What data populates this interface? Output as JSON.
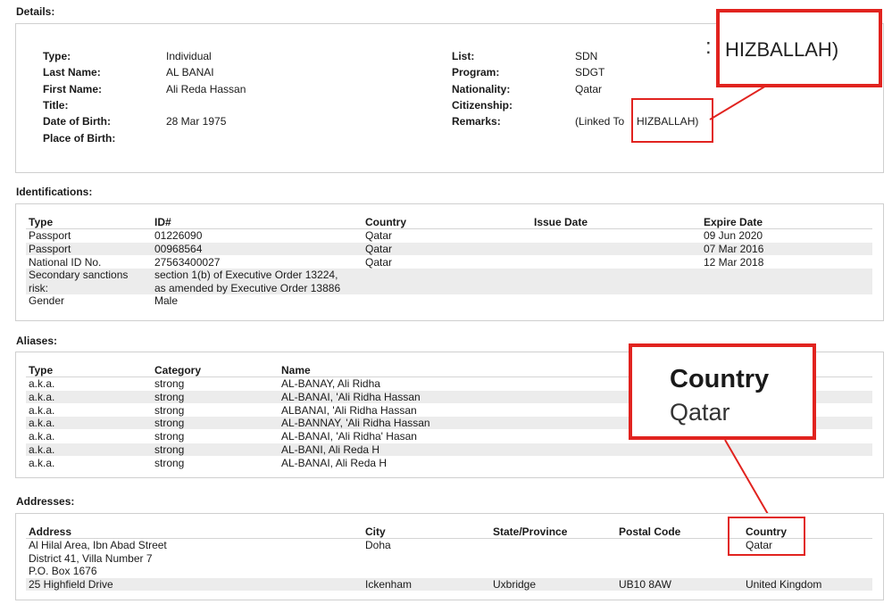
{
  "details": {
    "heading": "Details:",
    "left_fields": [
      {
        "label": "Type:",
        "value": "Individual"
      },
      {
        "label": "Last Name:",
        "value": "AL BANAI"
      },
      {
        "label": "First Name:",
        "value": "Ali Reda Hassan"
      },
      {
        "label": "Title:",
        "value": ""
      },
      {
        "label": "Date of Birth:",
        "value": "28 Mar 1975"
      },
      {
        "label": "Place of Birth:",
        "value": ""
      }
    ],
    "right_fields": [
      {
        "label": "List:",
        "value": "SDN"
      },
      {
        "label": "Program:",
        "value": "SDGT"
      },
      {
        "label": "Nationality:",
        "value": "Qatar"
      },
      {
        "label": "Citizenship:",
        "value": ""
      },
      {
        "label": "Remarks:",
        "value": "(Linked To"
      }
    ],
    "remarks_highlight": "HIZBALLAH)",
    "zoom_text": "HIZBALLAH)",
    "zoom_partial_char": ":"
  },
  "identifications": {
    "heading": "Identifications:",
    "headers": [
      "Type",
      "ID#",
      "Country",
      "Issue Date",
      "Expire Date"
    ],
    "rows": [
      [
        "Passport",
        "01226090",
        "Qatar",
        "",
        "09 Jun 2020"
      ],
      [
        "Passport",
        "00968564",
        "Qatar",
        "",
        "07 Mar 2016"
      ],
      [
        "National ID No.",
        "27563400027",
        "Qatar",
        "",
        "12 Mar 2018"
      ],
      [
        "Secondary sanctions",
        "section 1(b) of Executive Order 13224,",
        "",
        "",
        ""
      ],
      [
        "risk:",
        "as amended by Executive Order 13886",
        "",
        "",
        ""
      ],
      [
        "Gender",
        "Male",
        "",
        "",
        ""
      ]
    ]
  },
  "aliases": {
    "heading": "Aliases:",
    "headers": [
      "Type",
      "Category",
      "Name"
    ],
    "rows": [
      [
        "a.k.a.",
        "strong",
        "AL-BANAY, Ali Ridha"
      ],
      [
        "a.k.a.",
        "strong",
        "AL-BANAI, 'Ali Ridha Hassan"
      ],
      [
        "a.k.a.",
        "strong",
        "ALBANAI, 'Ali Ridha Hassan"
      ],
      [
        "a.k.a.",
        "strong",
        "AL-BANNAY, 'Ali Ridha Hassan"
      ],
      [
        "a.k.a.",
        "strong",
        "AL-BANAI, 'Ali Ridha' Hasan"
      ],
      [
        "a.k.a.",
        "strong",
        "AL-BANI, Ali Reda H"
      ],
      [
        "a.k.a.",
        "strong",
        "AL-BANAI, Ali Reda H"
      ]
    ],
    "zoom_header": "Country",
    "zoom_value": "Qatar"
  },
  "addresses": {
    "heading": "Addresses:",
    "headers": [
      "Address",
      "City",
      "State/Province",
      "Postal Code",
      "Country"
    ],
    "rows": [
      [
        "Al Hilal Area, Ibn Abad Street",
        "Doha",
        "",
        "",
        "Qatar"
      ],
      [
        "District 41, Villa Number 7",
        "",
        "",
        "",
        ""
      ],
      [
        "P.O. Box 1676",
        "",
        "",
        "",
        ""
      ],
      [
        "25 Highfield Drive",
        "Ickenham",
        "Uxbridge",
        "UB10 8AW",
        "United Kingdom"
      ]
    ]
  },
  "colors": {
    "highlight": "#e1231f",
    "border": "#cfcfcf",
    "stripe": "#ececec"
  }
}
